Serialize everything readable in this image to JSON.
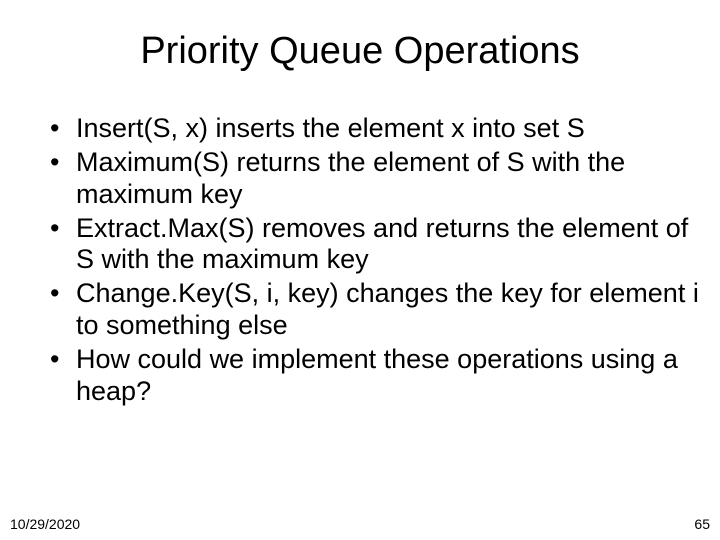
{
  "title": "Priority Queue Operations",
  "bullets": [
    "Insert(S, x) inserts the element x into set S",
    "Maximum(S) returns the element of S with the maximum key",
    "Extract.Max(S) removes and returns the element of S with the maximum key",
    "Change.Key(S, i, key) changes the key for element i to something else",
    "How could we implement these operations using a heap?"
  ],
  "footer": {
    "date": "10/29/2020",
    "page": "65"
  }
}
